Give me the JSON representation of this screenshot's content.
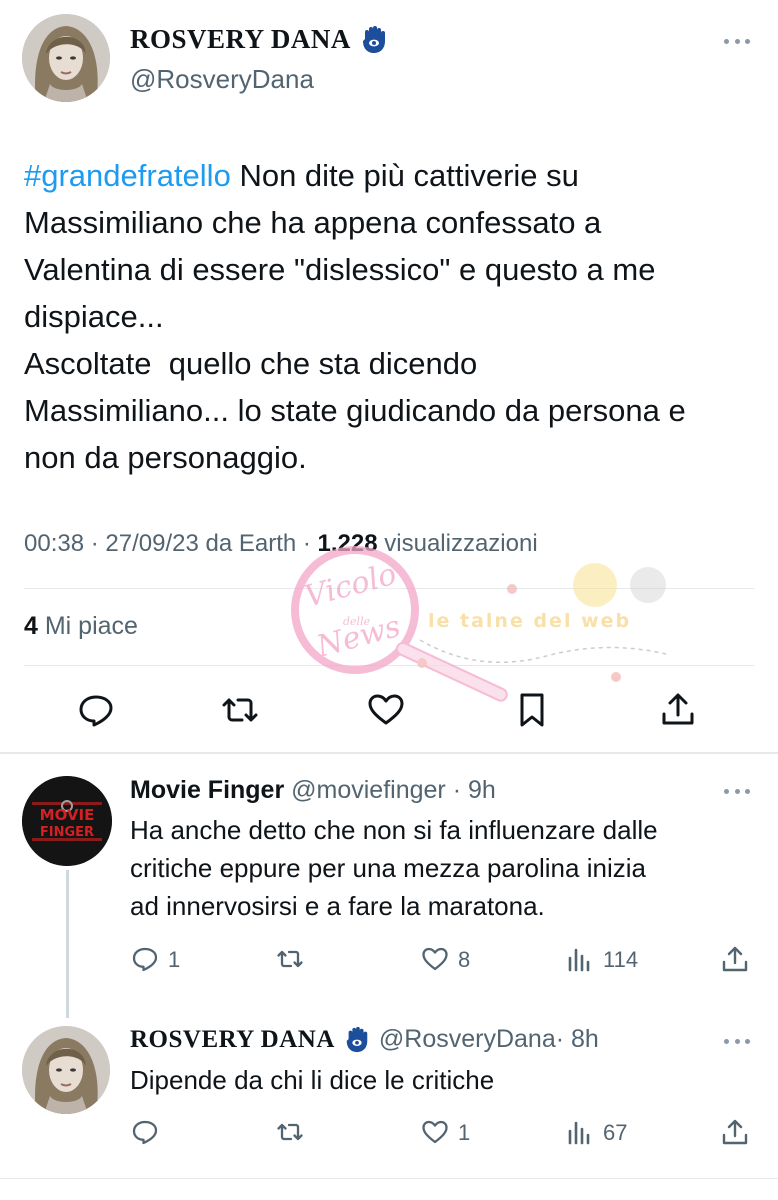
{
  "main_tweet": {
    "author_name": "ROSVERY DANA",
    "author_handle": "@RosveryDana",
    "hashtag": "#grandefratello",
    "body": " Non dite più cattiverie su\nMassimiliano che ha appena confessato a\nValentina di essere \"dislessico\" e questo a me\ndispiace...\nAscoltate  quello che sta dicendo\nMassimiliano... lo state giudicando da persona e\nnon da personaggio.",
    "time": "00:38 · 27/09/23 da Earth · ",
    "views_count": "1.228",
    "views_label": " visualizzazioni",
    "likes_count": "4",
    "likes_label": " Mi piace",
    "icons": [
      "reply-icon",
      "retweet-icon",
      "like-icon",
      "bookmark-icon",
      "share-icon"
    ]
  },
  "watermark": {
    "logo_text_top": "Vicolo",
    "logo_text_mid": "delle",
    "logo_text_bottom": "News",
    "site_text": "le talne del web"
  },
  "replies": [
    {
      "author_name": "Movie Finger",
      "author_handle": "@moviefinger",
      "time": " · 9h",
      "avatar_text_top": "MOVIE",
      "avatar_text_bottom": "FINGER",
      "text": "Ha anche detto che non si fa influenzare dalle\ncritiche eppure per una mezza parolina inizia\nad innervosirsi e a fare la maratona.",
      "reply_count": "1",
      "retweet_count": "",
      "like_count": "8",
      "view_count": "114"
    },
    {
      "author_name": "ROSVERY DANA",
      "author_handle": "@RosveryDana",
      "time": " · 8h",
      "text": "Dipende da chi li dice le critiche",
      "reply_count": "",
      "retweet_count": "",
      "like_count": "1",
      "view_count": "67"
    }
  ],
  "colors": {
    "accent": "#1d9bf0",
    "text": "#0f1419",
    "muted": "#536471",
    "hamsa": "#1c4e9c",
    "watermark_pink": "#f4a6c9"
  }
}
